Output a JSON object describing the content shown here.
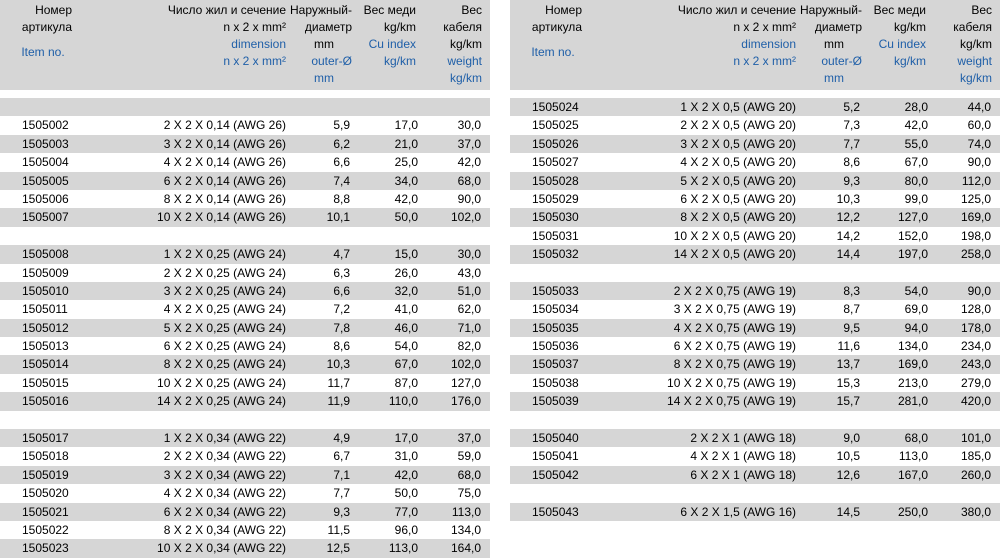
{
  "header": {
    "item": [
      "Номер",
      "артикула"
    ],
    "item_en": "Item no.",
    "dimension": [
      "Число жил и сечение",
      "n x 2 x mm²"
    ],
    "dimension_en": [
      "dimension",
      "n x 2 x mm²"
    ],
    "diameter": [
      "Наружный-",
      "диаметр",
      "mm"
    ],
    "diameter_en": [
      "outer-Ø",
      "mm"
    ],
    "copper": [
      "Вес меди",
      "kg/km"
    ],
    "copper_en": [
      "Cu index",
      "kg/km"
    ],
    "weight": [
      "Вес",
      "кабеля",
      "kg/km"
    ],
    "weight_en": [
      "weight",
      "kg/km"
    ]
  },
  "left_rows": [
    {
      "blank": true
    },
    {
      "item": "1505002",
      "dim": "2 X 2 X 0,14 (AWG 26)",
      "dia": "5,9",
      "cu": "17,0",
      "wt": "30,0"
    },
    {
      "item": "1505003",
      "dim": "3 X 2 X 0,14 (AWG 26)",
      "dia": "6,2",
      "cu": "21,0",
      "wt": "37,0"
    },
    {
      "item": "1505004",
      "dim": "4 X 2 X 0,14 (AWG 26)",
      "dia": "6,6",
      "cu": "25,0",
      "wt": "42,0"
    },
    {
      "item": "1505005",
      "dim": "6 X 2 X 0,14 (AWG 26)",
      "dia": "7,4",
      "cu": "34,0",
      "wt": "68,0"
    },
    {
      "item": "1505006",
      "dim": "8 X 2 X 0,14 (AWG 26)",
      "dia": "8,8",
      "cu": "42,0",
      "wt": "90,0"
    },
    {
      "item": "1505007",
      "dim": "10 X 2 X 0,14 (AWG 26)",
      "dia": "10,1",
      "cu": "50,0",
      "wt": "102,0"
    },
    {
      "blank": true
    },
    {
      "item": "1505008",
      "dim": "1 X 2 X 0,25 (AWG 24)",
      "dia": "4,7",
      "cu": "15,0",
      "wt": "30,0"
    },
    {
      "item": "1505009",
      "dim": "2 X 2 X 0,25 (AWG 24)",
      "dia": "6,3",
      "cu": "26,0",
      "wt": "43,0"
    },
    {
      "item": "1505010",
      "dim": "3 X 2 X 0,25 (AWG 24)",
      "dia": "6,6",
      "cu": "32,0",
      "wt": "51,0"
    },
    {
      "item": "1505011",
      "dim": "4 X 2 X 0,25 (AWG 24)",
      "dia": "7,2",
      "cu": "41,0",
      "wt": "62,0"
    },
    {
      "item": "1505012",
      "dim": "5 X 2 X 0,25 (AWG 24)",
      "dia": "7,8",
      "cu": "46,0",
      "wt": "71,0"
    },
    {
      "item": "1505013",
      "dim": "6 X 2 X 0,25 (AWG 24)",
      "dia": "8,6",
      "cu": "54,0",
      "wt": "82,0"
    },
    {
      "item": "1505014",
      "dim": "8 X 2 X 0,25 (AWG 24)",
      "dia": "10,3",
      "cu": "67,0",
      "wt": "102,0"
    },
    {
      "item": "1505015",
      "dim": "10 X 2 X 0,25 (AWG 24)",
      "dia": "11,7",
      "cu": "87,0",
      "wt": "127,0"
    },
    {
      "item": "1505016",
      "dim": "14 X 2 X 0,25 (AWG 24)",
      "dia": "11,9",
      "cu": "110,0",
      "wt": "176,0"
    },
    {
      "blank": true
    },
    {
      "item": "1505017",
      "dim": "1 X 2 X 0,34 (AWG 22)",
      "dia": "4,9",
      "cu": "17,0",
      "wt": "37,0"
    },
    {
      "item": "1505018",
      "dim": "2 X 2 X 0,34 (AWG 22)",
      "dia": "6,7",
      "cu": "31,0",
      "wt": "59,0"
    },
    {
      "item": "1505019",
      "dim": "3 X 2 X 0,34 (AWG 22)",
      "dia": "7,1",
      "cu": "42,0",
      "wt": "68,0"
    },
    {
      "item": "1505020",
      "dim": "4 X 2 X 0,34 (AWG 22)",
      "dia": "7,7",
      "cu": "50,0",
      "wt": "75,0"
    },
    {
      "item": "1505021",
      "dim": "6 X 2 X 0,34 (AWG 22)",
      "dia": "9,3",
      "cu": "77,0",
      "wt": "113,0"
    },
    {
      "item": "1505022",
      "dim": "8 X 2 X 0,34 (AWG 22)",
      "dia": "11,5",
      "cu": "96,0",
      "wt": "134,0"
    },
    {
      "item": "1505023",
      "dim": "10 X 2 X 0,34 (AWG 22)",
      "dia": "12,5",
      "cu": "113,0",
      "wt": "164,0"
    }
  ],
  "right_rows": [
    {
      "item": "1505024",
      "dim": "1 X 2 X 0,5 (AWG 20)",
      "dia": "5,2",
      "cu": "28,0",
      "wt": "44,0"
    },
    {
      "item": "1505025",
      "dim": "2 X 2 X 0,5 (AWG 20)",
      "dia": "7,3",
      "cu": "42,0",
      "wt": "60,0"
    },
    {
      "item": "1505026",
      "dim": "3 X 2 X 0,5 (AWG 20)",
      "dia": "7,7",
      "cu": "55,0",
      "wt": "74,0"
    },
    {
      "item": "1505027",
      "dim": "4 X 2 X 0,5 (AWG 20)",
      "dia": "8,6",
      "cu": "67,0",
      "wt": "90,0"
    },
    {
      "item": "1505028",
      "dim": "5 X 2 X 0,5 (AWG 20)",
      "dia": "9,3",
      "cu": "80,0",
      "wt": "112,0"
    },
    {
      "item": "1505029",
      "dim": "6 X 2 X 0,5 (AWG 20)",
      "dia": "10,3",
      "cu": "99,0",
      "wt": "125,0"
    },
    {
      "item": "1505030",
      "dim": "8 X 2 X 0,5 (AWG 20)",
      "dia": "12,2",
      "cu": "127,0",
      "wt": "169,0"
    },
    {
      "item": "1505031",
      "dim": "10 X 2 X 0,5 (AWG 20)",
      "dia": "14,2",
      "cu": "152,0",
      "wt": "198,0"
    },
    {
      "item": "1505032",
      "dim": "14 X 2 X 0,5 (AWG 20)",
      "dia": "14,4",
      "cu": "197,0",
      "wt": "258,0"
    },
    {
      "blank": true
    },
    {
      "item": "1505033",
      "dim": "2 X 2 X 0,75 (AWG 19)",
      "dia": "8,3",
      "cu": "54,0",
      "wt": "90,0"
    },
    {
      "item": "1505034",
      "dim": "3 X 2 X 0,75 (AWG 19)",
      "dia": "8,7",
      "cu": "69,0",
      "wt": "128,0"
    },
    {
      "item": "1505035",
      "dim": "4 X 2 X 0,75 (AWG 19)",
      "dia": "9,5",
      "cu": "94,0",
      "wt": "178,0"
    },
    {
      "item": "1505036",
      "dim": "6 X 2 X 0,75 (AWG 19)",
      "dia": "11,6",
      "cu": "134,0",
      "wt": "234,0"
    },
    {
      "item": "1505037",
      "dim": "8 X 2 X 0,75 (AWG 19)",
      "dia": "13,7",
      "cu": "169,0",
      "wt": "243,0"
    },
    {
      "item": "1505038",
      "dim": "10 X 2 X 0,75 (AWG 19)",
      "dia": "15,3",
      "cu": "213,0",
      "wt": "279,0"
    },
    {
      "item": "1505039",
      "dim": "14 X 2 X 0,75 (AWG 19)",
      "dia": "15,7",
      "cu": "281,0",
      "wt": "420,0"
    },
    {
      "blank": true
    },
    {
      "item": "1505040",
      "dim": "2 X 2 X 1 (AWG 18)",
      "dia": "9,0",
      "cu": "68,0",
      "wt": "101,0"
    },
    {
      "item": "1505041",
      "dim": "4 X 2 X 1 (AWG 18)",
      "dia": "10,5",
      "cu": "113,0",
      "wt": "185,0"
    },
    {
      "item": "1505042",
      "dim": "6 X 2 X 1 (AWG 18)",
      "dia": "12,6",
      "cu": "167,0",
      "wt": "260,0"
    },
    {
      "blank": true
    },
    {
      "item": "1505043",
      "dim": "6 X 2 X 1,5 (AWG 16)",
      "dia": "14,5",
      "cu": "250,0",
      "wt": "380,0"
    }
  ]
}
